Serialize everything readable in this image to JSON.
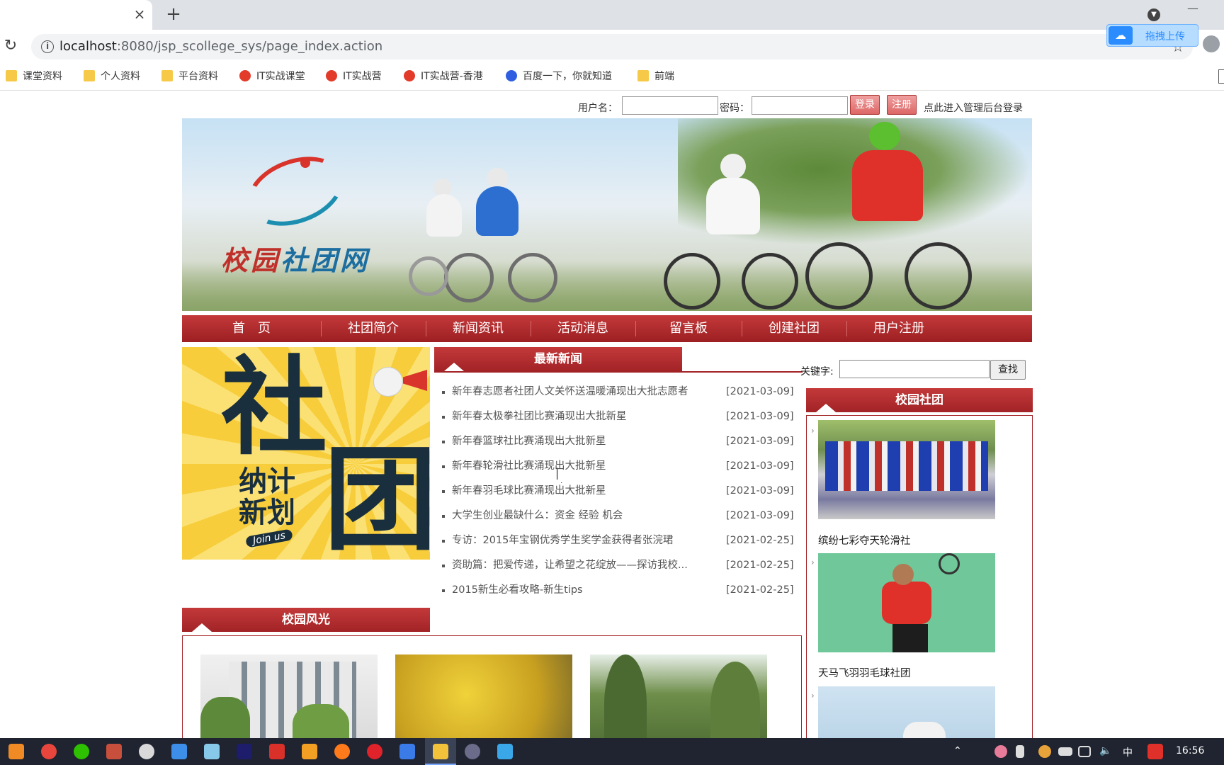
{
  "browser": {
    "new_tab": "+",
    "close_tab": "×",
    "url_host": "localhost",
    "url_path": ":8080/jsp_scollege_sys/page_index.action",
    "upload_button": "拖拽上传",
    "bookmarks": [
      {
        "label": "课堂资料",
        "icon": "folder-icon"
      },
      {
        "label": "个人资料",
        "icon": "folder-icon"
      },
      {
        "label": "平台资料",
        "icon": "folder-icon"
      },
      {
        "label": "IT实战课堂",
        "icon": "site-icon"
      },
      {
        "label": "IT实战营",
        "icon": "site-icon"
      },
      {
        "label": "IT实战营-香港",
        "icon": "site-icon"
      },
      {
        "label": "百度一下，你就知道",
        "icon": "baidu-icon"
      },
      {
        "label": "前端",
        "icon": "folder-icon"
      }
    ]
  },
  "login": {
    "username_label": "用户名：",
    "password_label": "密码：",
    "login_button": "登录",
    "register_button": "注册",
    "admin_link": "点此进入管理后台登录"
  },
  "banner": {
    "logo_text_a": "校园",
    "logo_text_b": "社团网"
  },
  "nav": {
    "items": [
      "首　页",
      "社团简介",
      "新闻资讯",
      "活动消息",
      "留言板",
      "创建社团",
      "用户注册"
    ]
  },
  "promo": {
    "char1": "社",
    "char2": "团",
    "line1": "纳计",
    "line2": "新划",
    "join": "Join us"
  },
  "news": {
    "title": "最新新闻",
    "items": [
      {
        "title": "新年春志愿者社团人文关怀送温暖涌现出大批志愿者",
        "date": "[2021-03-09]"
      },
      {
        "title": "新年春太极拳社团比赛涌现出大批新星",
        "date": "[2021-03-09]"
      },
      {
        "title": "新年春篮球社比赛涌现出大批新星",
        "date": "[2021-03-09]"
      },
      {
        "title": "新年春轮滑社比赛涌现出大批新星",
        "date": "[2021-03-09]"
      },
      {
        "title": "新年春羽毛球比赛涌现出大批新星",
        "date": "[2021-03-09]"
      },
      {
        "title": "大学生创业最缺什么：资金 经验 机会",
        "date": "[2021-03-09]"
      },
      {
        "title": "专访：2015年宝钢优秀学生奖学金获得者张浣珺",
        "date": "[2021-02-25]"
      },
      {
        "title": "资助篇：把爱传递，让希望之花绽放——探访我校...",
        "date": "[2021-02-25]"
      },
      {
        "title": "2015新生必看攻略-新生tips",
        "date": "[2021-02-25]"
      }
    ]
  },
  "search": {
    "label": "关键字:",
    "button": "查找"
  },
  "clubs": {
    "title": "校园社团",
    "items": [
      {
        "name": "缤纷七彩夺天轮滑社"
      },
      {
        "name": "天马飞羽羽毛球社团"
      },
      {
        "name": ""
      }
    ]
  },
  "scenery": {
    "title": "校园风光"
  },
  "taskbar": {
    "ime": "中",
    "time": "16:56"
  },
  "colors": {
    "brand_red": "#a22326",
    "nav_gradient_top": "#c4393a"
  }
}
